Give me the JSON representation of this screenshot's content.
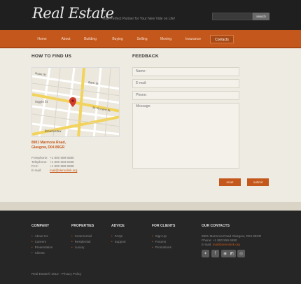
{
  "header": {
    "logo": "Real Estate",
    "tagline": "Your Perfect Partner for Your New Vide on Life!",
    "search_placeholder": "",
    "search_button": "search"
  },
  "nav": {
    "items": [
      "Home",
      "About",
      "Building",
      "Buying",
      "Selling",
      "Moving",
      "Insurance",
      "Contacts"
    ],
    "active": "Contacts"
  },
  "find_us": {
    "title": "HOW TO FIND US",
    "address_line1": "8901 Marmora Road,",
    "address_line2": "Glasgow, D04 89GR",
    "freephone_label": "Freephone:",
    "freephone": "+1 800 559 6580",
    "telephone_label": "Telephone:",
    "telephone": "+1 800 603 6035",
    "fax_label": "FAX:",
    "fax": "+1 800 889 9898",
    "email_label": "E-mail:",
    "email": "mail@demolink.org"
  },
  "feedback": {
    "title": "FEEDBACK",
    "name_placeholder": "Name:",
    "email_placeholder": "E-mail:",
    "phone_placeholder": "Phone:",
    "message_placeholder": "Message:",
    "reset_label": "reset",
    "submit_label": "submit"
  },
  "footer": {
    "columns": [
      {
        "title": "COMPANY",
        "items": [
          "About Us",
          "Careers",
          "Presentation",
          "Clients"
        ]
      },
      {
        "title": "PROPERTIES",
        "items": [
          "Commercial",
          "Residential",
          "Luxury"
        ]
      },
      {
        "title": "ADVICE",
        "items": [
          "FAQs",
          "Support"
        ]
      },
      {
        "title": "FOR CLIENTS",
        "items": [
          "Sign Up",
          "Forums",
          "Promotions"
        ]
      }
    ],
    "contacts_title": "OUR CONTACTS",
    "contacts_address": "8901 Marmora Road Glasgow, D04 89GR",
    "contacts_phone": "Phone: +1 800 559 6580",
    "contacts_email_label": "E-mail:",
    "contacts_email": "mail@demolink.org",
    "social_icons": [
      "twitter-icon",
      "facebook-icon",
      "rss-icon",
      "delicious-icon",
      "globe-icon"
    ],
    "copyright": "Real Estate© 2012 - Privacy Policy"
  },
  "colors": {
    "accent": "#c4581c",
    "header_bg": "#1f1f1f",
    "content_bg": "#eeebe2",
    "footer_bg": "#262626"
  }
}
